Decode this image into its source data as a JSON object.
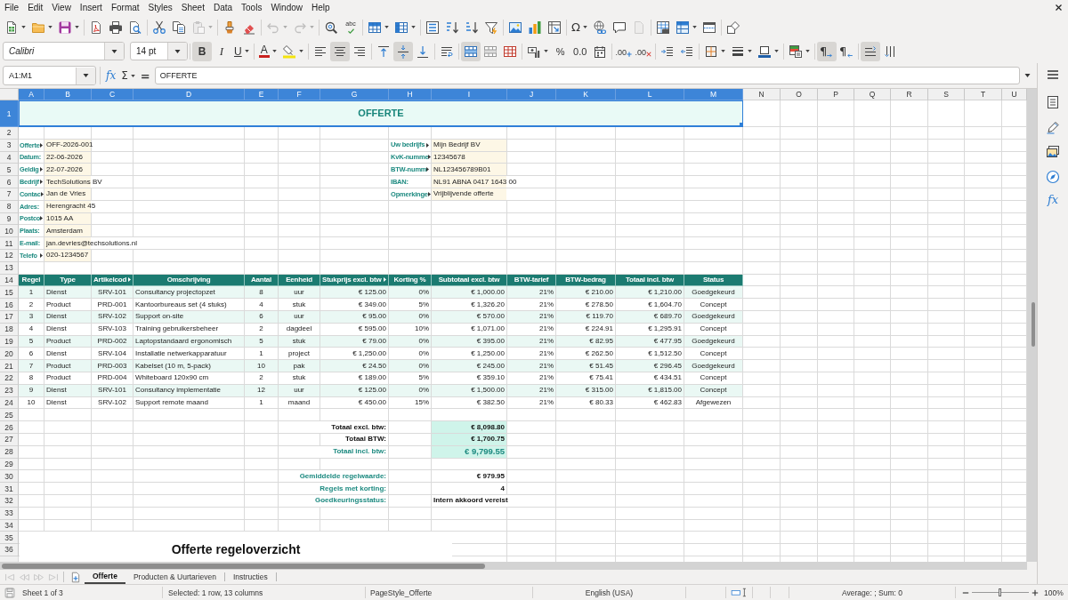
{
  "menu_bar": {
    "items": [
      "File",
      "Edit",
      "View",
      "Insert",
      "Format",
      "Styles",
      "Sheet",
      "Data",
      "Tools",
      "Window",
      "Help"
    ]
  },
  "standard_toolbar": {
    "paste_disabled": true,
    "undo_disabled": true,
    "redo_disabled": true,
    "header_footer_disabled": true,
    "spelling_label": "abc",
    "special_character_label": "Ω"
  },
  "formatting_toolbar": {
    "font_name": "Calibri",
    "font_size": "14 pt",
    "style_buttons": [
      {
        "kind": "bold",
        "label": "B",
        "pressed": true
      },
      {
        "kind": "italic",
        "label": "I",
        "pressed": false
      },
      {
        "kind": "underline",
        "label": "U",
        "pressed": false
      }
    ],
    "font_color_label": "A",
    "horizontal_align": [
      {
        "kind": "left",
        "selected": false
      },
      {
        "kind": "center",
        "selected": true
      },
      {
        "kind": "right",
        "selected": false
      }
    ],
    "vertical_align": [
      {
        "kind": "top",
        "selected": false
      },
      {
        "kind": "middle",
        "selected": true
      },
      {
        "kind": "bottom",
        "selected": false
      }
    ],
    "merge_buttons": [
      {
        "kind": "merge_center",
        "pressed": true
      },
      {
        "kind": "merge",
        "pressed": false
      },
      {
        "kind": "unmerge",
        "pressed": false
      }
    ],
    "percent_label": "%",
    "number_label": "0.0",
    "decimal_buttons": [
      {
        "kind": "add",
        "label": ".00"
      },
      {
        "kind": "delete",
        "label": ".00"
      }
    ],
    "paragraph_direction": [
      {
        "kind": "ltr",
        "label": "¶",
        "selected": true
      },
      {
        "kind": "rtl",
        "label": "¶",
        "selected": false
      }
    ],
    "text_direction": [
      {
        "kind": "horizontal",
        "selected": true
      },
      {
        "kind": "vertical",
        "selected": false
      }
    ]
  },
  "formula_bar": {
    "name_box": "A1:M1",
    "function_wizard_label": "fx",
    "sum_label": "Σ",
    "equals_label": "=",
    "content": "OFFERTE"
  },
  "sheet": {
    "columns": [
      {
        "label": "A",
        "selected": true
      },
      {
        "label": "B",
        "selected": true
      },
      {
        "label": "C",
        "selected": true
      },
      {
        "label": "D",
        "selected": true
      },
      {
        "label": "E",
        "selected": true
      },
      {
        "label": "F",
        "selected": true
      },
      {
        "label": "G",
        "selected": true
      },
      {
        "label": "H",
        "selected": true
      },
      {
        "label": "I",
        "selected": true
      },
      {
        "label": "J",
        "selected": true
      },
      {
        "label": "K",
        "selected": true
      },
      {
        "label": "L",
        "selected": true
      },
      {
        "label": "M",
        "selected": true
      },
      {
        "label": "N",
        "selected": false
      },
      {
        "label": "O",
        "selected": false
      },
      {
        "label": "P",
        "selected": false
      },
      {
        "label": "Q",
        "selected": false
      },
      {
        "label": "R",
        "selected": false
      },
      {
        "label": "S",
        "selected": false
      },
      {
        "label": "T",
        "selected": false
      },
      {
        "label": "U",
        "selected": false
      }
    ],
    "rows": [
      {
        "label": "1",
        "selected": true
      },
      {
        "label": "2",
        "selected": false
      },
      {
        "label": "3",
        "selected": false
      },
      {
        "label": "4",
        "selected": false
      },
      {
        "label": "5",
        "selected": false
      },
      {
        "label": "6",
        "selected": false
      },
      {
        "label": "7",
        "selected": false
      },
      {
        "label": "8",
        "selected": false
      },
      {
        "label": "9",
        "selected": false
      },
      {
        "label": "10",
        "selected": false
      },
      {
        "label": "11",
        "selected": false
      },
      {
        "label": "12",
        "selected": false
      },
      {
        "label": "13",
        "selected": false
      },
      {
        "label": "14",
        "selected": false
      },
      {
        "label": "15",
        "selected": false
      },
      {
        "label": "16",
        "selected": false
      },
      {
        "label": "17",
        "selected": false
      },
      {
        "label": "18",
        "selected": false
      },
      {
        "label": "19",
        "selected": false
      },
      {
        "label": "20",
        "selected": false
      },
      {
        "label": "21",
        "selected": false
      },
      {
        "label": "22",
        "selected": false
      },
      {
        "label": "23",
        "selected": false
      },
      {
        "label": "24",
        "selected": false
      },
      {
        "label": "25",
        "selected": false
      },
      {
        "label": "26",
        "selected": false
      },
      {
        "label": "27",
        "selected": false
      },
      {
        "label": "28",
        "selected": false
      },
      {
        "label": "29",
        "selected": false
      },
      {
        "label": "30",
        "selected": false
      },
      {
        "label": "31",
        "selected": false
      },
      {
        "label": "32",
        "selected": false
      },
      {
        "label": "33",
        "selected": false
      },
      {
        "label": "34",
        "selected": false
      },
      {
        "label": "35",
        "selected": false
      },
      {
        "label": "36",
        "selected": false
      }
    ],
    "title": {
      "text": "OFFERTE",
      "selected": true
    },
    "customer_fields": [
      {
        "label": "Offerte",
        "clipped": true,
        "value": "OFF-2026-001"
      },
      {
        "label": "Datum:",
        "clipped": false,
        "value": "22-06-2026"
      },
      {
        "label": "Geldig",
        "clipped": true,
        "value": "22-07-2026"
      },
      {
        "label": "Bedrijf",
        "clipped": true,
        "value": "TechSolutions BV"
      },
      {
        "label": "Contac",
        "clipped": true,
        "value": "Jan de Vries"
      },
      {
        "label": "Adres:",
        "clipped": false,
        "value": "Herengracht 45"
      },
      {
        "label": "Postco",
        "clipped": true,
        "value": "1015 AA"
      },
      {
        "label": "Plaats:",
        "clipped": false,
        "value": "Amsterdam"
      },
      {
        "label": "E-mail:",
        "clipped": false,
        "value": "jan.devries@techsolutions.nl"
      },
      {
        "label": "Telefo",
        "clipped": true,
        "value": "020-1234567"
      }
    ],
    "company_fields": [
      {
        "label": "Uw bedrijfs",
        "clipped": true,
        "value": "Mijn Bedrijf BV"
      },
      {
        "label": "KvK-numme",
        "clipped": true,
        "value": "12345678"
      },
      {
        "label": "BTW-numm",
        "clipped": true,
        "value": "NL123456789B01"
      },
      {
        "label": "IBAN:",
        "clipped": false,
        "value": "NL91 ABNA 0417 1643 00"
      },
      {
        "label": "Opmerkinge",
        "clipped": true,
        "value": "Vrijblijvende offerte"
      }
    ],
    "line_items": {
      "columns": [
        {
          "label": "Regel",
          "clipped": false
        },
        {
          "label": "Type",
          "clipped": false
        },
        {
          "label": "Artikelcod",
          "clipped": true
        },
        {
          "label": "Omschrijving",
          "clipped": false
        },
        {
          "label": "Aantal",
          "clipped": false
        },
        {
          "label": "Eenheid",
          "clipped": false
        },
        {
          "label": "Stukprijs excl. btw",
          "clipped": true
        },
        {
          "label": "Korting %",
          "clipped": false
        },
        {
          "label": "Subtotaal excl. btw",
          "clipped": false
        },
        {
          "label": "BTW-tarief",
          "clipped": false
        },
        {
          "label": "BTW-bedrag",
          "clipped": false
        },
        {
          "label": "Totaal incl. btw",
          "clipped": false
        },
        {
          "label": "Status",
          "clipped": false
        }
      ],
      "rows": [
        {
          "cells": [
            "1",
            "Dienst",
            "SRV-101",
            "Consultancy projectopzet",
            "8",
            "uur",
            "€ 125.00",
            "0%",
            "€ 1,000.00",
            "21%",
            "€ 210.00",
            "€ 1,210.00",
            "Goedgekeurd"
          ]
        },
        {
          "cells": [
            "2",
            "Product",
            "PRD-001",
            "Kantoorbureaus set (4 stuks)",
            "4",
            "stuk",
            "€ 349.00",
            "5%",
            "€ 1,326.20",
            "21%",
            "€ 278.50",
            "€ 1,604.70",
            "Concept"
          ]
        },
        {
          "cells": [
            "3",
            "Dienst",
            "SRV-102",
            "Support on-site",
            "6",
            "uur",
            "€ 95.00",
            "0%",
            "€ 570.00",
            "21%",
            "€ 119.70",
            "€ 689.70",
            "Goedgekeurd"
          ]
        },
        {
          "cells": [
            "4",
            "Dienst",
            "SRV-103",
            "Training gebruikersbeheer",
            "2",
            "dagdeel",
            "€ 595.00",
            "10%",
            "€ 1,071.00",
            "21%",
            "€ 224.91",
            "€ 1,295.91",
            "Concept"
          ]
        },
        {
          "cells": [
            "5",
            "Product",
            "PRD-002",
            "Laptopstandaard ergonomisch",
            "5",
            "stuk",
            "€ 79.00",
            "0%",
            "€ 395.00",
            "21%",
            "€ 82.95",
            "€ 477.95",
            "Goedgekeurd"
          ]
        },
        {
          "cells": [
            "6",
            "Dienst",
            "SRV-104",
            "Installatie netwerkapparatuur",
            "1",
            "project",
            "€ 1,250.00",
            "0%",
            "€ 1,250.00",
            "21%",
            "€ 262.50",
            "€ 1,512.50",
            "Concept"
          ]
        },
        {
          "cells": [
            "7",
            "Product",
            "PRD-003",
            "Kabelset (10 m, 5-pack)",
            "10",
            "pak",
            "€ 24.50",
            "0%",
            "€ 245.00",
            "21%",
            "€ 51.45",
            "€ 296.45",
            "Goedgekeurd"
          ]
        },
        {
          "cells": [
            "8",
            "Product",
            "PRD-004",
            "Whiteboard 120x90 cm",
            "2",
            "stuk",
            "€ 189.00",
            "5%",
            "€ 359.10",
            "21%",
            "€ 75.41",
            "€ 434.51",
            "Concept"
          ]
        },
        {
          "cells": [
            "9",
            "Dienst",
            "SRV-101",
            "Consultancy implementatie",
            "12",
            "uur",
            "€ 125.00",
            "0%",
            "€ 1,500.00",
            "21%",
            "€ 315.00",
            "€ 1,815.00",
            "Concept"
          ]
        },
        {
          "cells": [
            "10",
            "Dienst",
            "SRV-102",
            "Support remote maand",
            "1",
            "maand",
            "€ 450.00",
            "15%",
            "€ 382.50",
            "21%",
            "€ 80.33",
            "€ 462.83",
            "Afgewezen"
          ]
        }
      ]
    },
    "totals": [
      {
        "kind": "subtotal",
        "label": "Totaal excl. btw:",
        "value": "€ 8,098.80"
      },
      {
        "kind": "subtotal",
        "label": "Totaal BTW:",
        "value": "€ 1,700.75"
      },
      {
        "kind": "grand_total",
        "label": "Totaal incl. btw:",
        "value": "€ 9,799.55"
      }
    ],
    "statistics": [
      {
        "kind": "number",
        "label": "Gemiddelde regelwaarde:",
        "value": "€ 979.95"
      },
      {
        "kind": "number",
        "label": "Regels met korting:",
        "value": "4"
      },
      {
        "kind": "text",
        "label": "Goedkeuringsstatus:",
        "value": "Intern akkoord vereist"
      }
    ],
    "chart": {
      "title": "Offerte regeloverzicht"
    }
  },
  "sheet_tabs": {
    "navigation_disabled": true,
    "tabs": [
      {
        "label": "Offerte",
        "selected": true
      },
      {
        "label": "Producten & Uurtarieven",
        "selected": false
      },
      {
        "label": "Instructies",
        "selected": false
      }
    ]
  },
  "status_bar": {
    "sheet": "Sheet 1 of 3",
    "selection": "Selected: 1 row, 13 columns",
    "page_style": "PageStyle_Offerte",
    "language": "English (USA)",
    "summary": "Average: ; Sum: 0",
    "zoom_slider": {
      "level": 0.5
    },
    "zoom": "100%"
  },
  "sidebar": {
    "functions_label": "fx"
  }
}
